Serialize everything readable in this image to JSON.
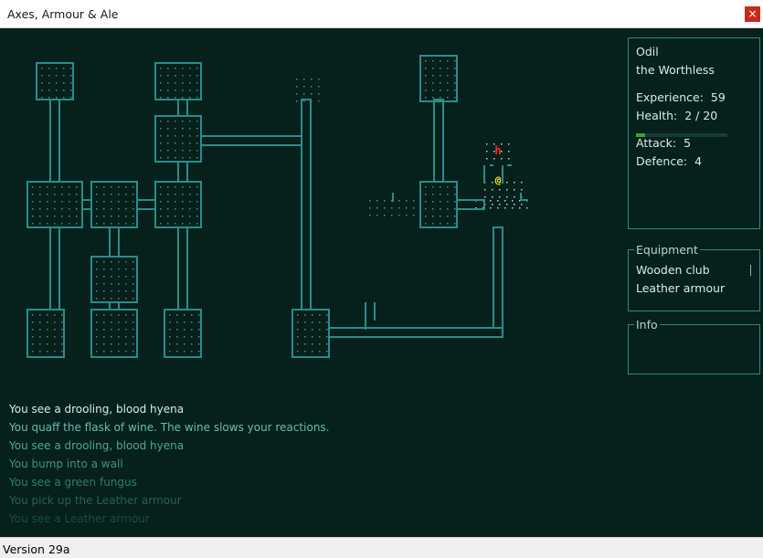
{
  "window": {
    "title": "Axes, Armour & Ale",
    "close_glyph": "×"
  },
  "map": {
    "wall_color": "#2a8c8c",
    "floor_color": "#5e8a83",
    "lit_floor_color": "#b5d5cd",
    "player": {
      "glyph": "@",
      "color": "#ffee00"
    },
    "monster": {
      "glyph": "h",
      "color": "#ff2a2a",
      "name": "blood hyena"
    }
  },
  "character": {
    "name": "Odil",
    "epithet": "the Worthless",
    "experience_label": "Experience:",
    "experience": "59",
    "health_label": "Health:",
    "health_current": 2,
    "health_max": 20,
    "health_text": "2 / 20",
    "health_bar_color": "#3aa03a",
    "attack_label": "Attack:",
    "attack": "5",
    "defence_label": "Defence:",
    "defence": "4"
  },
  "equipment": {
    "title": "Equipment",
    "items": [
      "Wooden club",
      "Leather armour"
    ]
  },
  "info": {
    "title": "Info"
  },
  "messages": [
    {
      "text": "You see a drooling, blood hyena",
      "color": "#d4ece8"
    },
    {
      "text": "You quaff the flask of wine. The wine slows your reactions.",
      "color": "#6cbab0"
    },
    {
      "text": "You see a drooling, blood hyena",
      "color": "#4fa49a"
    },
    {
      "text": "You bump into a wall",
      "color": "#3f9088"
    },
    {
      "text": "You see a green fungus",
      "color": "#2f7a72"
    },
    {
      "text": "You pick up the Leather armour",
      "color": "#24625c"
    },
    {
      "text": "You see a Leather armour",
      "color": "#1a4c47"
    }
  ],
  "status": {
    "version": "Version 29a"
  }
}
